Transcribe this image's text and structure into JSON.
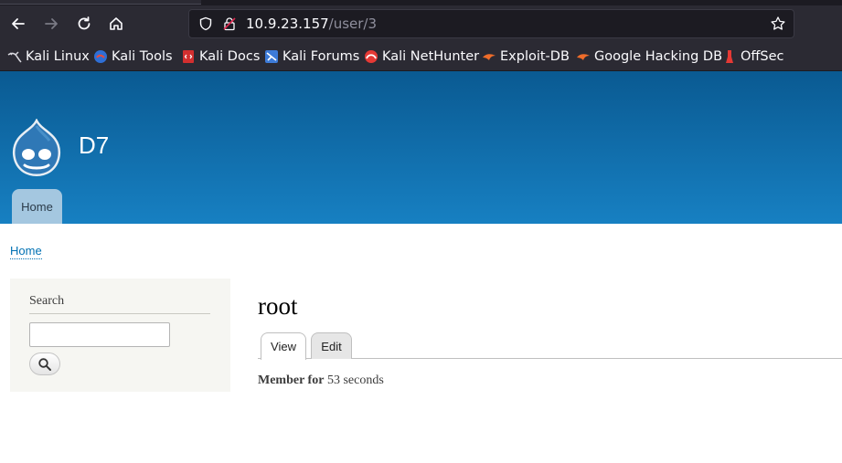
{
  "browser": {
    "url_host": "10.9.23.157",
    "url_path": "/user/3",
    "buttons": {
      "back_icon": "arrow-left-icon",
      "forward_icon": "arrow-right-icon",
      "reload_icon": "reload-icon",
      "home_icon": "home-icon"
    },
    "bookmarks": [
      {
        "label": "Kali Linux",
        "icon": "kali-dragon-icon"
      },
      {
        "label": "Kali Tools",
        "icon": "kali-tools-icon"
      },
      {
        "label": "Kali Docs",
        "icon": "kali-docs-icon"
      },
      {
        "label": "Kali Forums",
        "icon": "kali-forums-icon"
      },
      {
        "label": "Kali NetHunter",
        "icon": "nethunter-icon"
      },
      {
        "label": "Exploit-DB",
        "icon": "exploit-db-icon"
      },
      {
        "label": "Google Hacking DB",
        "icon": "ghdb-icon"
      },
      {
        "label": "OffSec",
        "icon": "offsec-icon"
      }
    ]
  },
  "site": {
    "name": "D7",
    "nav": {
      "home_tab": "Home"
    }
  },
  "breadcrumb": {
    "home": "Home"
  },
  "sidebar": {
    "search_title": "Search",
    "search_value": ""
  },
  "main": {
    "title": "root",
    "tabs": [
      {
        "label": "View"
      },
      {
        "label": "Edit"
      }
    ],
    "member_label": "Member for",
    "member_value": "53 seconds"
  },
  "colors": {
    "header_top": "#0a5a92",
    "header_bottom": "#1780c2",
    "link": "#0071b3",
    "chrome_bg": "#2b2a33"
  }
}
